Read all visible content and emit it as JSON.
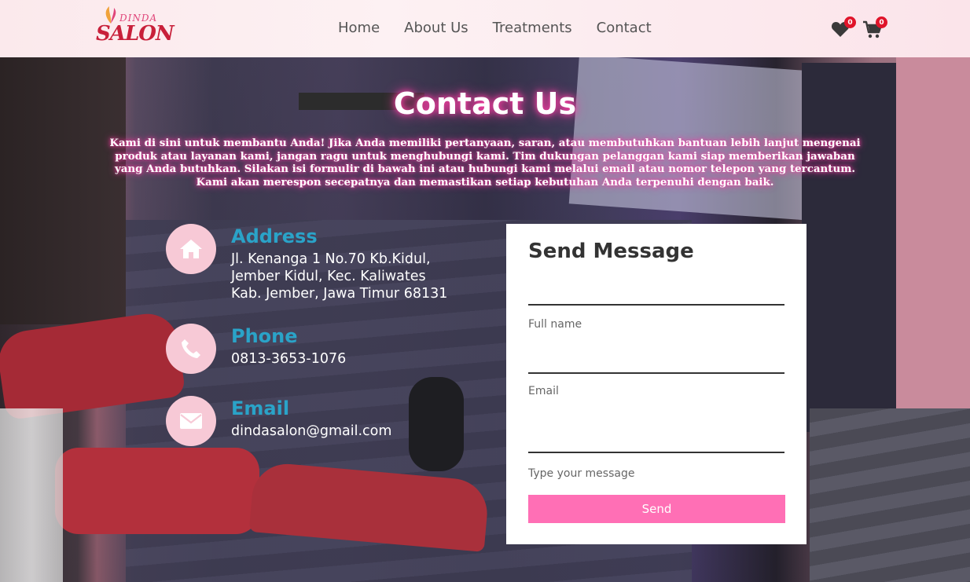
{
  "brand": {
    "logo_text_top": "DINDA",
    "logo_text_main": "SALON"
  },
  "nav": {
    "items": [
      "Home",
      "About Us",
      "Treatments",
      "Contact"
    ]
  },
  "header_icons": {
    "wishlist_count": "0",
    "cart_count": "0",
    "wishlist_icon": "heart-icon",
    "cart_icon": "cart-icon"
  },
  "hero": {
    "title": "Contact Us",
    "intro": "Kami di sini untuk membantu Anda! Jika Anda memiliki pertanyaan, saran, atau membutuhkan bantuan lebih lanjut mengenai produk atau layanan kami, jangan ragu untuk menghubungi kami. Tim dukungan pelanggan kami siap memberikan jawaban yang Anda butuhkan. Silakan isi formulir di bawah ini atau hubungi kami melalui email atau nomor telepon yang tercantum. Kami akan merespon secepatnya dan memastikan setiap kebutuhan Anda terpenuhi dengan baik."
  },
  "contact_info": {
    "address": {
      "title": "Address",
      "line1": "Jl. Kenanga 1 No.70 Kb.Kidul,",
      "line2": "Jember Kidul, Kec. Kaliwates",
      "line3": "Kab. Jember, Jawa Timur 68131",
      "icon": "home-icon"
    },
    "phone": {
      "title": "Phone",
      "value": "0813-3653-1076",
      "icon": "phone-icon"
    },
    "email": {
      "title": "Email",
      "value": "dindasalon@gmail.com",
      "icon": "envelope-icon"
    }
  },
  "form": {
    "title": "Send Message",
    "fullname_label": "Full name",
    "email_label": "Email",
    "message_label": "Type your message",
    "fullname_value": "",
    "email_value": "",
    "message_value": "",
    "send_label": "Send"
  },
  "colors": {
    "accent_pink": "#ff6fb5",
    "info_title": "#2aa3c8",
    "icon_circle": "#f7c9d6",
    "badge": "#e0142a"
  }
}
